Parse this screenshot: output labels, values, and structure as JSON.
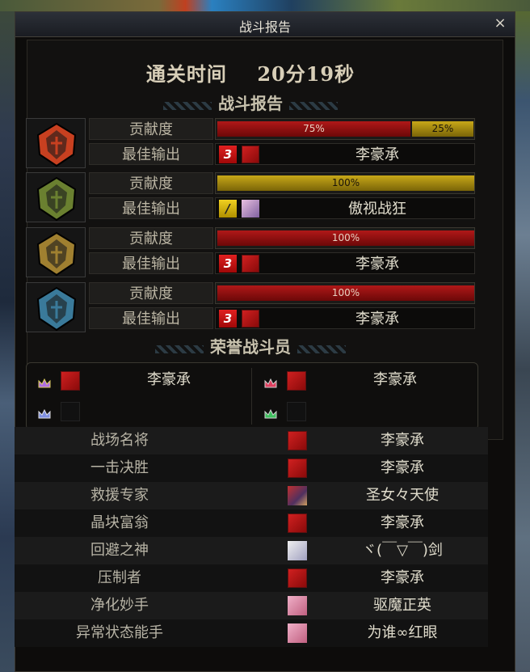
{
  "window": {
    "title": "战斗报告",
    "close": "×"
  },
  "clear_time": {
    "label": "通关时间",
    "value": "20分19秒"
  },
  "report_heading": "战斗报告",
  "teams": [
    {
      "contrib_label": "贡献度",
      "best_label": "最佳输出",
      "red_pct": "75%",
      "gold_pct": "25%",
      "red_fraction": 0.75,
      "gold_fraction": 0.25,
      "skill_icon": "3",
      "best_name": "李豪承",
      "portrait": "red-helm-icon",
      "color": "#c84020"
    },
    {
      "contrib_label": "贡献度",
      "best_label": "最佳输出",
      "gold_pct": "100%",
      "gold_fraction": 1.0,
      "skill_icon": "/",
      "best_name": "傲视战狂",
      "portrait": "green-helm-icon",
      "color": "#6a8030"
    },
    {
      "contrib_label": "贡献度",
      "best_label": "最佳输出",
      "red_pct": "100%",
      "red_fraction": 1.0,
      "skill_icon": "3",
      "best_name": "李豪承",
      "portrait": "gold-helm-icon",
      "color": "#a08030"
    },
    {
      "contrib_label": "贡献度",
      "best_label": "最佳输出",
      "red_pct": "100%",
      "red_fraction": 1.0,
      "skill_icon": "3",
      "best_name": "李豪承",
      "portrait": "blue-helm-icon",
      "color": "#3a7a9a"
    }
  ],
  "honor_heading": "荣誉战斗员",
  "honor": [
    {
      "name": "李豪承",
      "crown": "purple-crown-icon"
    },
    {
      "name": "李豪承",
      "crown": "red-crown-icon"
    },
    {
      "name": "",
      "crown": "blue-crown-icon"
    },
    {
      "name": "",
      "crown": "green-crown-icon"
    }
  ],
  "awards": [
    {
      "title": "战场名将",
      "name": "李豪承"
    },
    {
      "title": "一击决胜",
      "name": "李豪承"
    },
    {
      "title": "救援专家",
      "name": "圣女々天使"
    },
    {
      "title": "晶块富翁",
      "name": "李豪承"
    },
    {
      "title": "回避之神",
      "name": "ヾ(￣▽￣)剑"
    },
    {
      "title": "压制者",
      "name": "李豪承"
    },
    {
      "title": "净化妙手",
      "name": "驱魔正英"
    },
    {
      "title": "异常状态能手",
      "name": "为谁∞红眼"
    }
  ]
}
